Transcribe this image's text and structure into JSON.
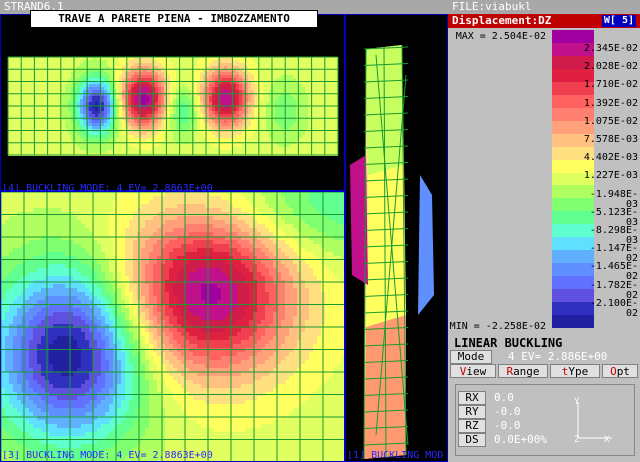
{
  "app": {
    "title": "STRAND6.1",
    "file": "FILE:viabukl"
  },
  "plot": {
    "title": "TRAVE A PARETE PIENA - IMBOZZAMENTO",
    "caption_top": "[4] BUCKLING MODE: 4 EV= 2.8863E+00",
    "caption_bottom": "[3] BUCKLING MODE: 4 EV= 2.8863E+00",
    "caption_side": "[1] BUCKLING MOD"
  },
  "legend": {
    "title": "Displacement:DZ",
    "window_btn": "W[ 5]",
    "max_label": "MAX = 2.504E-02",
    "min_label": "MIN = -2.258E-02",
    "labels": [
      "2.345E-02",
      "2.028E-02",
      "1.710E-02",
      "1.392E-02",
      "1.075E-02",
      "7.578E-03",
      "4.402E-03",
      "1.227E-03",
      "-1.948E-03",
      "-5.123E-03",
      "-8.298E-03",
      "-1.147E-02",
      "-1.465E-02",
      "-1.782E-02",
      "-2.100E-02"
    ],
    "colors": [
      "#a000a0",
      "#c0108c",
      "#d01c4a",
      "#e02040",
      "#f04050",
      "#ff6060",
      "#ff8070",
      "#ffa07a",
      "#ffc080",
      "#ffe080",
      "#ffff60",
      "#e0ff60",
      "#b0ff60",
      "#80ff70",
      "#60ff90",
      "#60ffd0",
      "#60e0ff",
      "#60b0ff",
      "#6090ff",
      "#6070ff",
      "#6050e0",
      "#3030c0",
      "#2020a0"
    ]
  },
  "analysis": {
    "type": "LINEAR BUCKLING",
    "mode_label": "Mode",
    "mode_value": "4 EV= 2.886E+00"
  },
  "menu": [
    {
      "hot": "V",
      "rest": "iew"
    },
    {
      "hot": "R",
      "rest": "ange"
    },
    {
      "hot": "t",
      "rest": "Ype",
      "prefix": ""
    },
    {
      "hot": "O",
      "rest": "pt"
    }
  ],
  "rotations": [
    {
      "label": "RX",
      "value": "0.0"
    },
    {
      "label": "RY",
      "value": "-0.0"
    },
    {
      "label": "RZ",
      "value": "-0.0"
    },
    {
      "label": "DS",
      "value": "0.0E+00%"
    }
  ],
  "triad": {
    "y": "Y",
    "z": "Z",
    "x": "X"
  }
}
